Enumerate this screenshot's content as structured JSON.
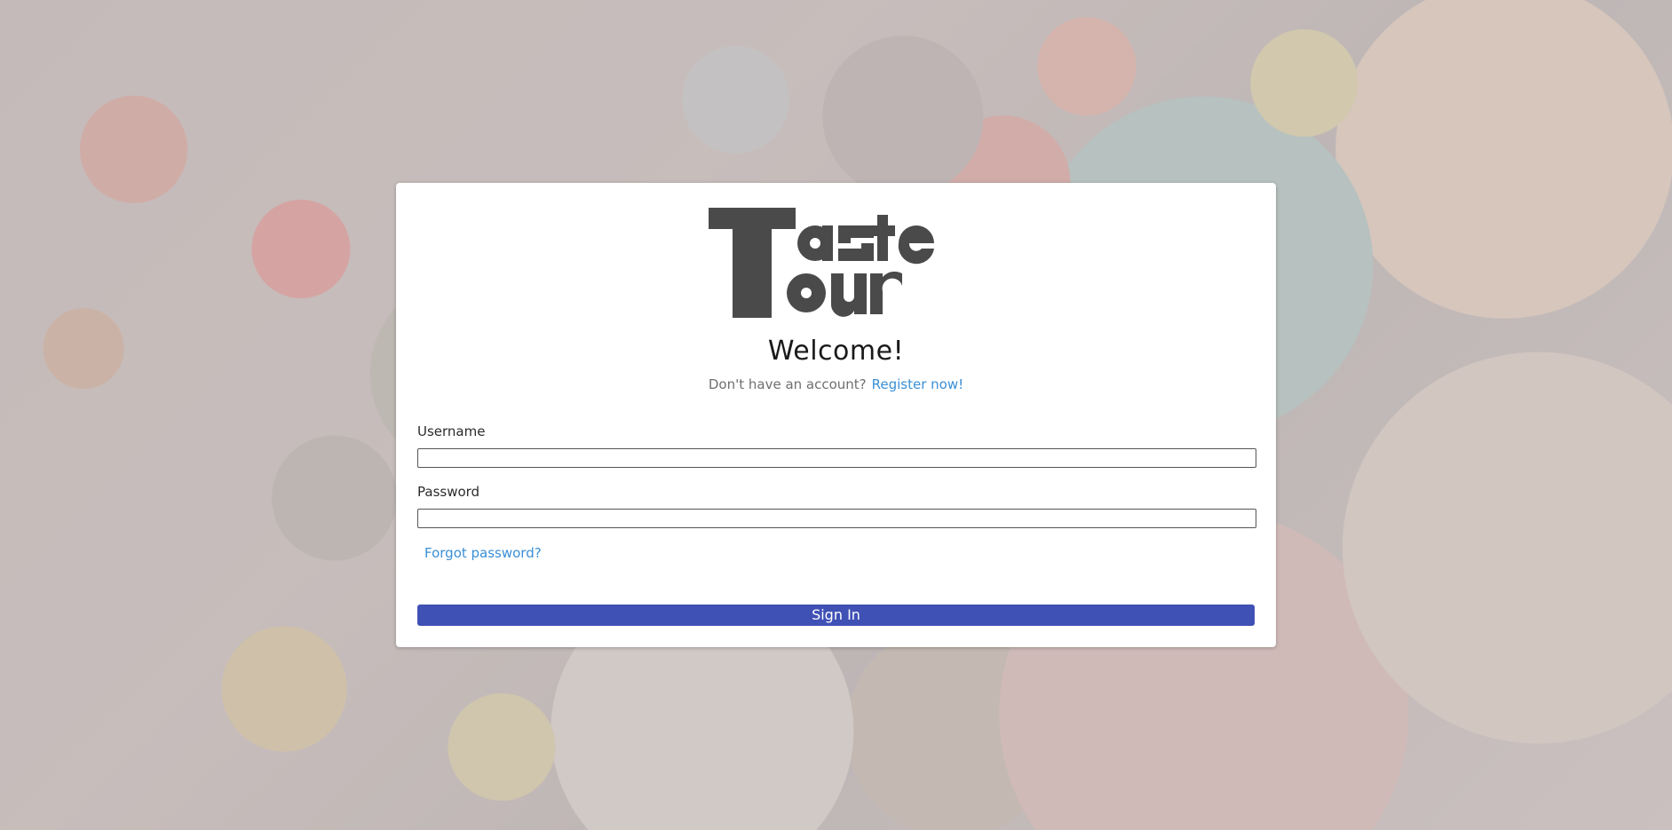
{
  "brand": {
    "logo_text": "Taste Tour",
    "logo_color": "#4a4a4a"
  },
  "login": {
    "heading": "Welcome!",
    "no_account_text": "Don't have an account?",
    "register_link": "Register now!",
    "username_label": "Username",
    "username_value": "",
    "password_label": "Password",
    "password_value": "",
    "forgot_link": "Forgot password?",
    "signin_label": "Sign In"
  },
  "colors": {
    "primary_button": "#3f51b5",
    "link": "#3a8fd6"
  }
}
